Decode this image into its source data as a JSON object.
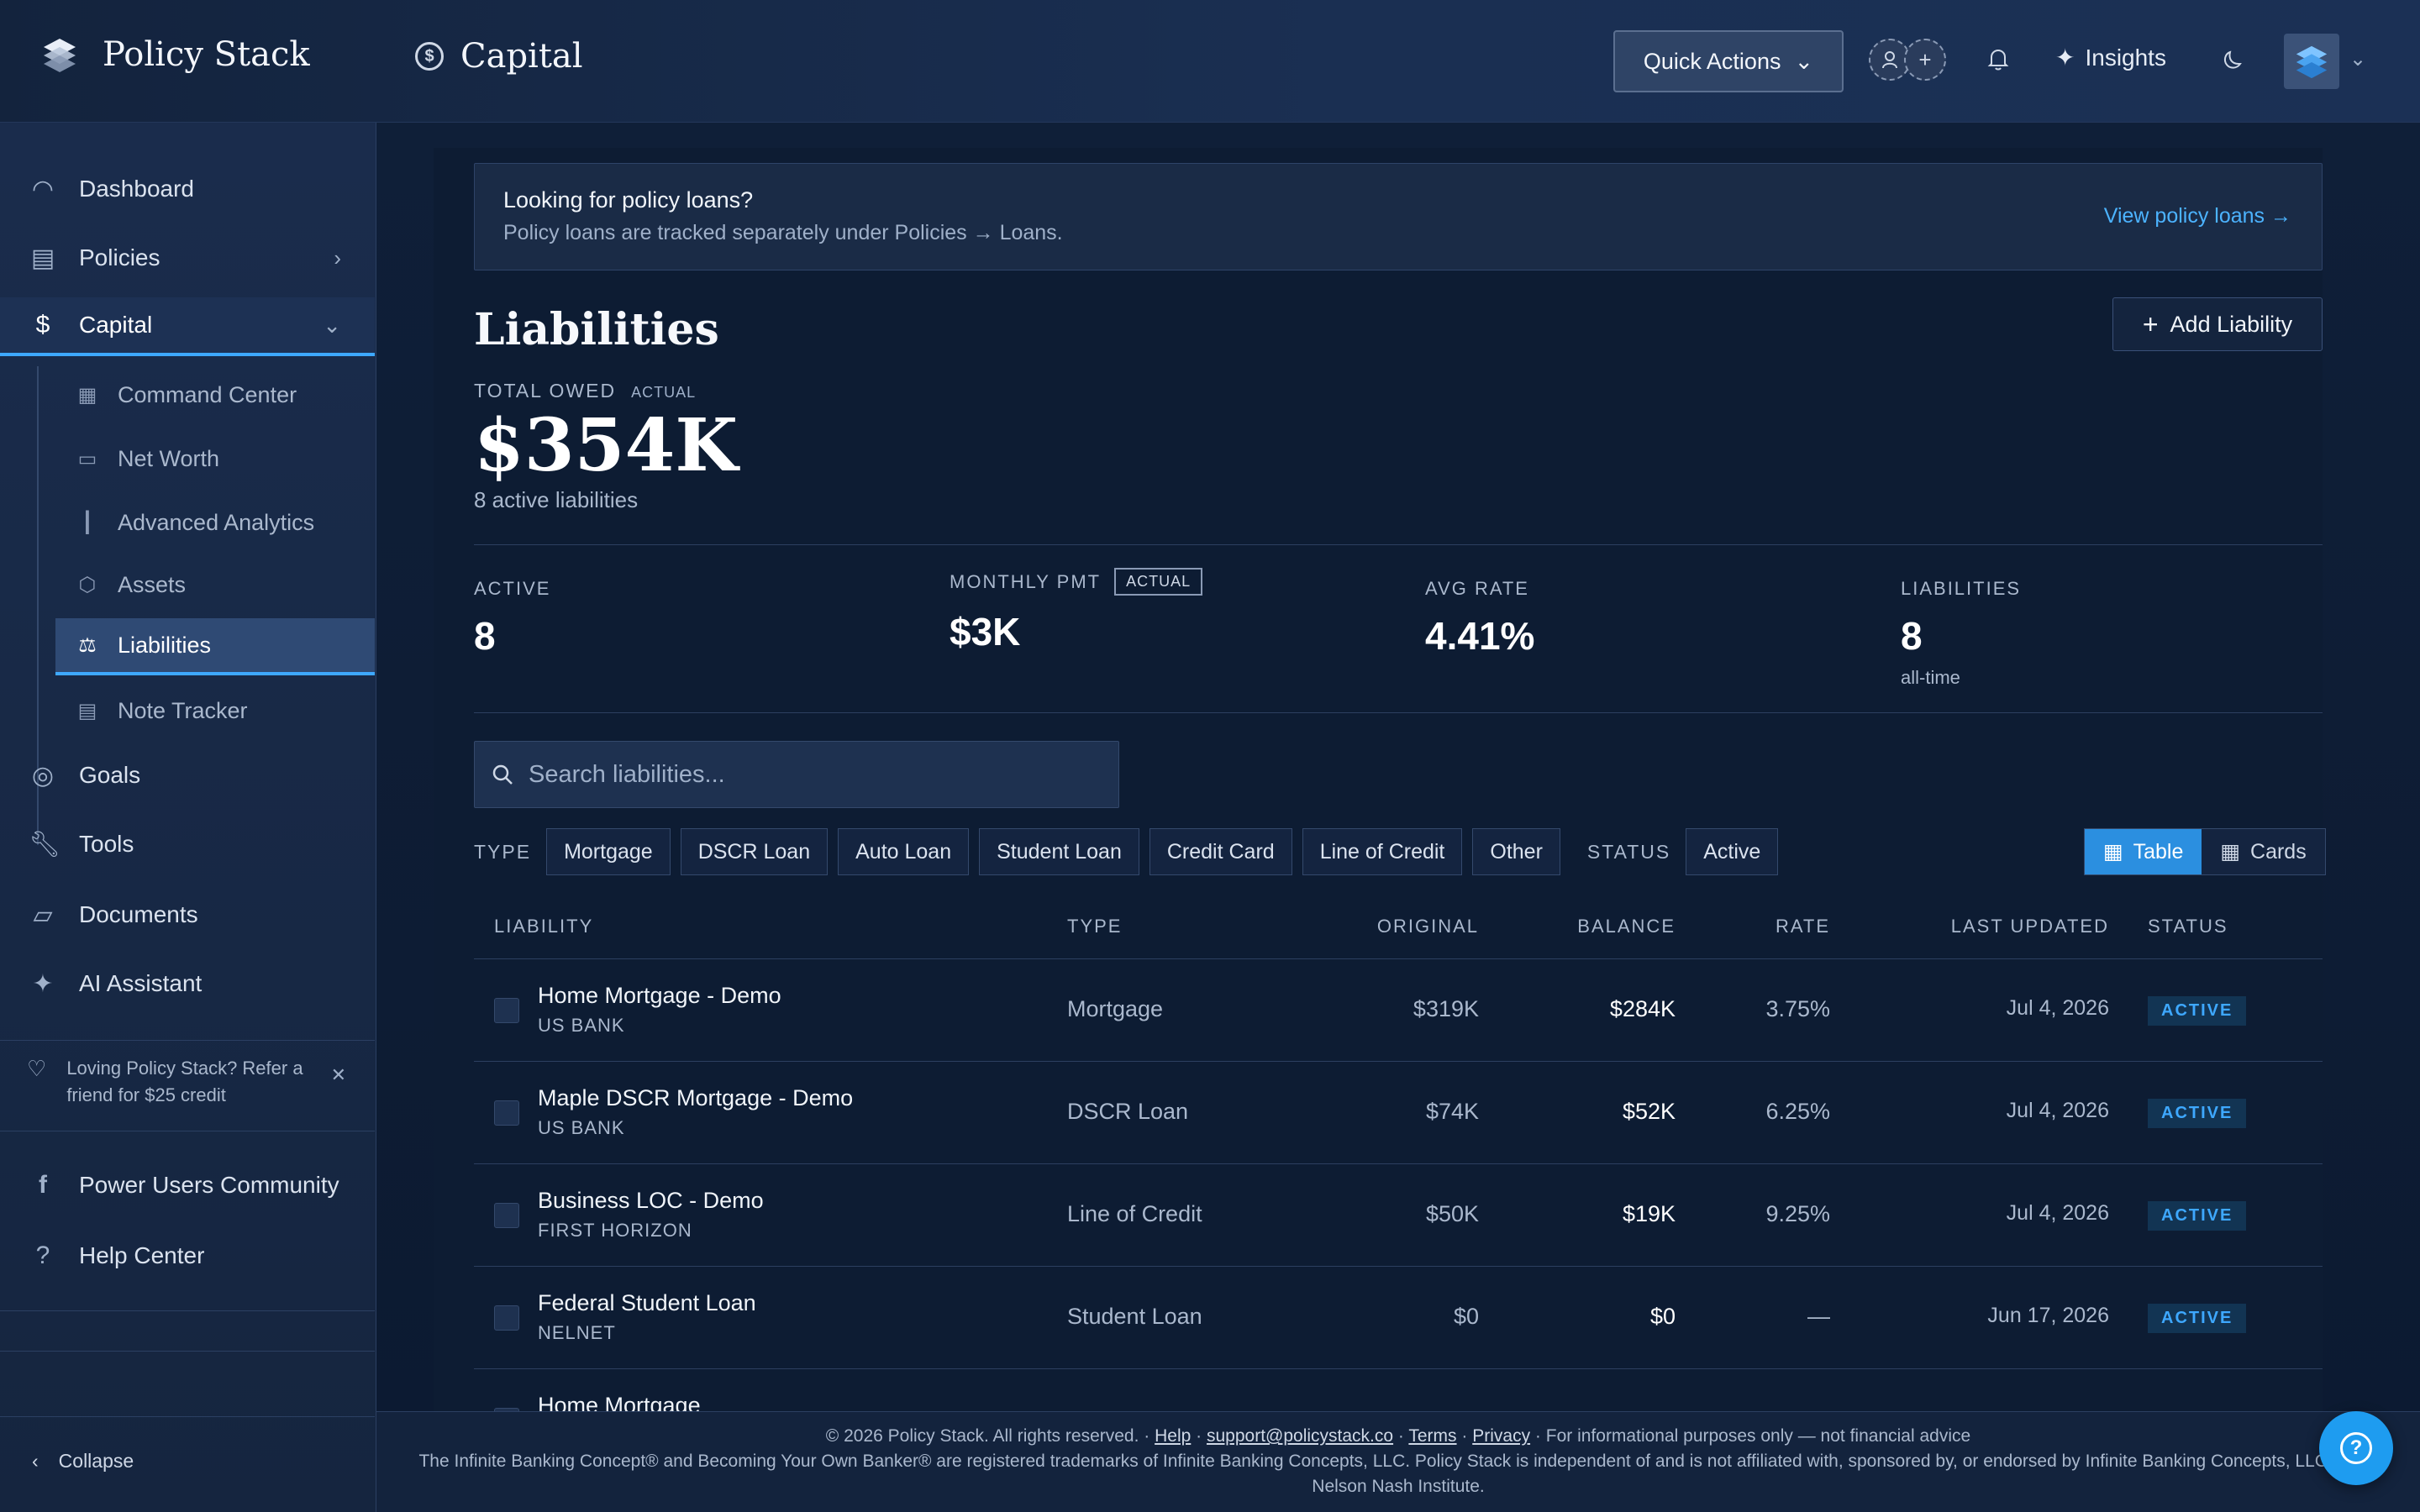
{
  "brand": {
    "name": "Policy Stack"
  },
  "header": {
    "section": "Capital",
    "quick_actions": "Quick Actions",
    "insights": "Insights"
  },
  "sidebar": {
    "items": [
      {
        "label": "Dashboard",
        "icon": "gauge-icon"
      },
      {
        "label": "Policies",
        "icon": "document-icon"
      },
      {
        "label": "Capital",
        "icon": "dollar-circle-icon"
      },
      {
        "label": "Goals",
        "icon": "target-icon"
      },
      {
        "label": "Tools",
        "icon": "wrench-icon"
      },
      {
        "label": "Documents",
        "icon": "folder-icon"
      },
      {
        "label": "AI Assistant",
        "icon": "sparkle-icon"
      }
    ],
    "sub_items": [
      {
        "label": "Command Center",
        "icon": "grid-icon"
      },
      {
        "label": "Net Worth",
        "icon": "wallet-icon"
      },
      {
        "label": "Advanced Analytics",
        "icon": "bar-chart-icon"
      },
      {
        "label": "Assets",
        "icon": "hexagon-icon"
      },
      {
        "label": "Liabilities",
        "icon": "scale-icon"
      },
      {
        "label": "Note Tracker",
        "icon": "note-icon"
      }
    ],
    "refer": "Loving Policy Stack? Refer a friend for $25 credit",
    "community": "Power Users Community",
    "help": "Help Center",
    "collapse": "Collapse"
  },
  "notice": {
    "title": "Looking for policy loans?",
    "body": "Policy loans are tracked separately under Policies → Loans.",
    "link": "View policy loans →"
  },
  "page": {
    "title": "Liabilities",
    "add_button": "Add Liability",
    "total_label": "TOTAL OWED",
    "total_tag": "ACTUAL",
    "total_value": "$354K",
    "total_sub": "8 active liabilities"
  },
  "stats": [
    {
      "label": "ACTIVE",
      "value": "8",
      "sub": ""
    },
    {
      "label": "MONTHLY PMT",
      "tag": "ACTUAL",
      "value": "$3K",
      "sub": ""
    },
    {
      "label": "AVG RATE",
      "value": "4.41%",
      "sub": ""
    },
    {
      "label": "LIABILITIES",
      "value": "8",
      "sub": "all-time"
    }
  ],
  "search": {
    "placeholder": "Search liabilities..."
  },
  "filters": {
    "type_label": "TYPE",
    "types": [
      "Mortgage",
      "DSCR Loan",
      "Auto Loan",
      "Student Loan",
      "Credit Card",
      "Line of Credit",
      "Other"
    ],
    "status_label": "STATUS",
    "status": "Active"
  },
  "view": {
    "table": "Table",
    "cards": "Cards",
    "selected": "Table"
  },
  "table": {
    "headers": [
      "LIABILITY",
      "TYPE",
      "ORIGINAL",
      "BALANCE",
      "RATE",
      "LAST UPDATED",
      "STATUS"
    ],
    "rows": [
      {
        "name": "Home Mortgage - Demo",
        "bank": "US BANK",
        "type": "Mortgage",
        "original": "$319K",
        "balance": "$284K",
        "rate": "3.75%",
        "updated": "Jul 4, 2026",
        "status": "ACTIVE"
      },
      {
        "name": "Maple DSCR Mortgage - Demo",
        "bank": "US BANK",
        "type": "DSCR Loan",
        "original": "$74K",
        "balance": "$52K",
        "rate": "6.25%",
        "updated": "Jul 4, 2026",
        "status": "ACTIVE"
      },
      {
        "name": "Business LOC - Demo",
        "bank": "FIRST HORIZON",
        "type": "Line of Credit",
        "original": "$50K",
        "balance": "$19K",
        "rate": "9.25%",
        "updated": "Jul 4, 2026",
        "status": "ACTIVE"
      },
      {
        "name": "Federal Student Loan",
        "bank": "NELNET",
        "type": "Student Loan",
        "original": "$0",
        "balance": "$0",
        "rate": "—",
        "updated": "Jun 17, 2026",
        "status": "ACTIVE"
      },
      {
        "name": "Home Mortgage",
        "bank": "",
        "type": "",
        "original": "",
        "balance": "",
        "rate": "",
        "updated": "",
        "status": ""
      }
    ]
  },
  "footer": {
    "copyright": "© 2026 Policy Stack. All rights reserved. ·",
    "help": "Help",
    "email": "support@policystack.co",
    "terms": "Terms",
    "privacy": "Privacy",
    "disclaimer": "· For informational purposes only — not financial advice",
    "trademark": "The Infinite Banking Concept® and Becoming Your Own Banker® are registered trademarks of Infinite Banking Concepts, LLC. Policy Stack is independent of and is not affiliated with, sponsored by, or endorsed by Infinite Banking Concepts, LLC or the Nelson Nash Institute."
  },
  "colors": {
    "accent": "#3ea8ff",
    "background": "#0f1e36",
    "sidebar": "#1a2c4c"
  }
}
